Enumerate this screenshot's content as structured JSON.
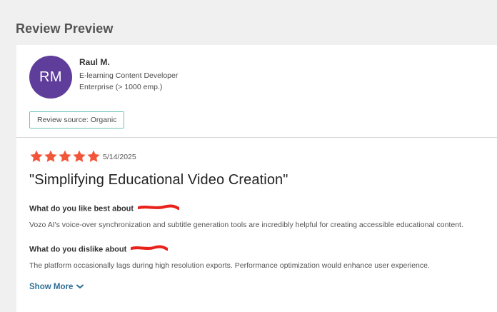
{
  "page": {
    "title": "Review Preview"
  },
  "reviewer": {
    "initials": "RM",
    "name": "Raul M.",
    "role": "E-learning Content Developer",
    "company_size": "Enterprise (> 1000 emp.)",
    "avatar_color": "#5f3e9b"
  },
  "source": {
    "label": "Review source: Organic",
    "border_color": "#6cc3b8"
  },
  "review": {
    "rating": 5,
    "rating_max": 5,
    "star_color": "#f2563a",
    "date": "5/14/2025",
    "title": "\"Simplifying Educational Video Creation\"",
    "questions": [
      {
        "heading": "What do you like best about",
        "answer": "Vozo AI's voice-over synchronization and subtitle generation tools are incredibly helpful for creating accessible educational content."
      },
      {
        "heading": "What do you dislike about",
        "answer": "The platform occasionally lags during high resolution exports. Performance optimization would enhance user experience."
      }
    ],
    "redaction_color": "#e8211a"
  },
  "actions": {
    "show_more": "Show More",
    "show_more_icon": "chevron-down-icon",
    "link_color": "#2b6e96"
  }
}
